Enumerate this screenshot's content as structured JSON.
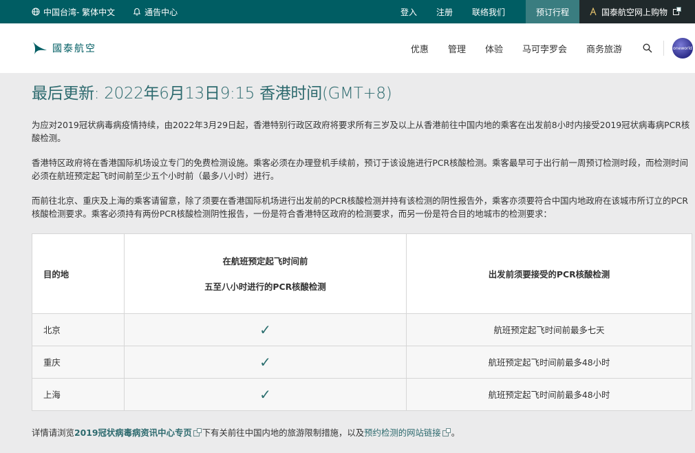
{
  "topbar": {
    "region": "中国台湾- 繁体中文",
    "notices": "通告中心",
    "login": "登入",
    "register": "注册",
    "contact": "联络我们",
    "manage_booking": "预订行程",
    "shop": "国泰航空网上购物"
  },
  "nav": {
    "brand": "國泰航空",
    "items": [
      "优惠",
      "管理",
      "体验",
      "马可孛罗会",
      "商务旅游"
    ],
    "partner": "oneworld"
  },
  "page": {
    "title": "最后更新: 2022年6月13日9:15 香港时间(GMT+8)",
    "para1": "为应对2019冠状病毒病疫情持续，由2022年3月29日起，香港特别行政区政府将要求所有三岁及以上从香港前往中国内地的乘客在出发前8小时内接受2019冠状病毒病PCR核酸检测。",
    "para2": "香港特区政府将在香港国际机场设立专门的免费检测设施。乘客必须在办理登机手续前，预订于该设施进行PCR核酸检测。乘客最早可于出行前一周预订检测时段，而检测时间必须在航班预定起飞时间前至少五个小时前（最多八小时）进行。",
    "para3": "而前往北京、重庆及上海的乘客请留意，除了须要在香港国际机场进行出发前的PCR核酸检测并持有该检测的阴性报告外，乘客亦须要符合中国内地政府在该城市所订立的PCR核酸检测要求。乘客必须持有两份PCR核酸检测阴性报告，一份是符合香港特区政府的检测要求，而另一份是符合目的地城市的检测要求："
  },
  "table": {
    "headers": {
      "destination": "目的地",
      "hk_test_line1": "在航班预定起飞时间前",
      "hk_test_line2": "五至八小时进行的PCR核酸检测",
      "dest_test": "出发前须要接受的PCR核酸检测"
    },
    "rows": [
      {
        "city": "北京",
        "check": "✓",
        "requirement": "航班预定起飞时间前最多七天"
      },
      {
        "city": "重庆",
        "check": "✓",
        "requirement": "航班预定起飞时间前最多48小时"
      },
      {
        "city": "上海",
        "check": "✓",
        "requirement": "航班预定起飞时间前最多48小时"
      }
    ]
  },
  "footer": {
    "prefix": "详情请浏览",
    "link1": "2019冠状病毒病资讯中心专页",
    "middle": "下有关前往中国内地的旅游限制措施，以及",
    "link2": "预约检测的网站链接",
    "suffix": "。"
  }
}
